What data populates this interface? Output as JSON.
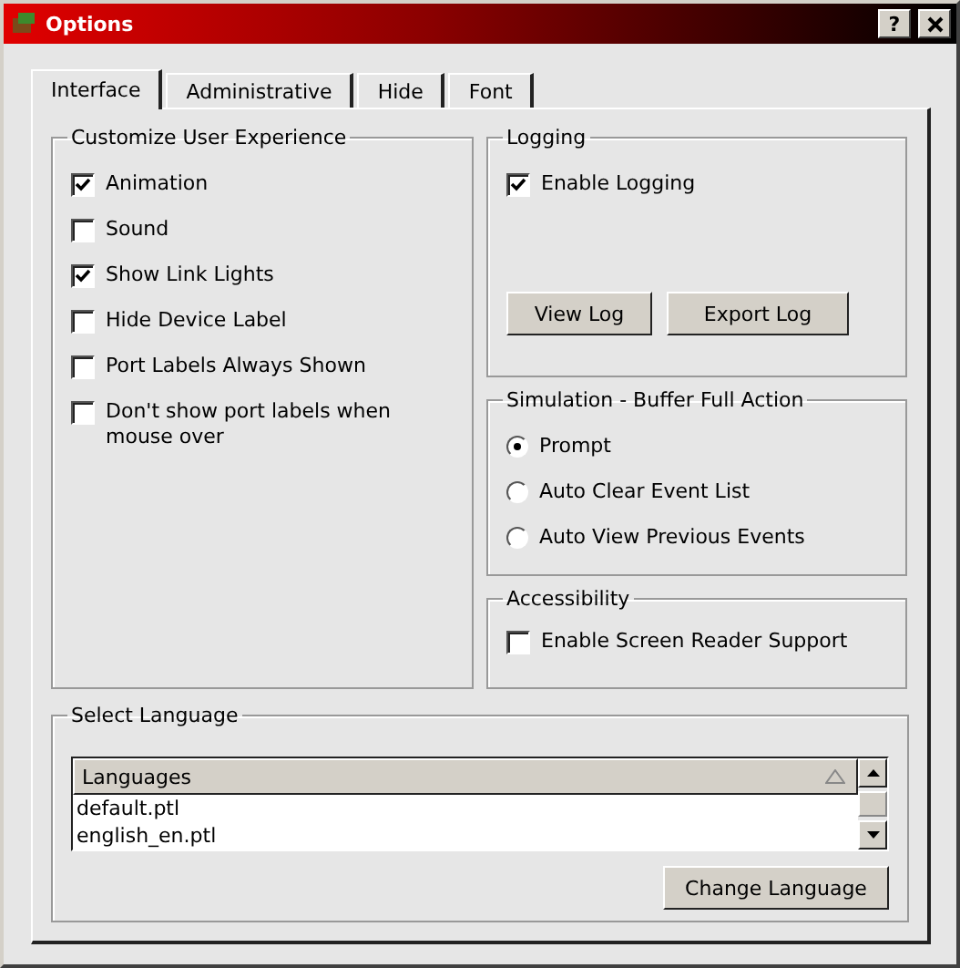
{
  "window": {
    "title": "Options",
    "help_button": "?"
  },
  "tabs": [
    {
      "label": "Interface",
      "selected": true
    },
    {
      "label": "Administrative",
      "selected": false
    },
    {
      "label": "Hide",
      "selected": false
    },
    {
      "label": "Font",
      "selected": false
    }
  ],
  "customize": {
    "title": "Customize User Experience",
    "options": [
      {
        "label": "Animation",
        "checked": true
      },
      {
        "label": "Sound",
        "checked": false
      },
      {
        "label": "Show Link Lights",
        "checked": true
      },
      {
        "label": "Hide Device Label",
        "checked": false
      },
      {
        "label": "Port Labels Always Shown",
        "checked": false
      },
      {
        "label": "Don't show port labels when mouse over",
        "checked": false
      }
    ]
  },
  "logging": {
    "title": "Logging",
    "option": {
      "label": "Enable Logging",
      "checked": true
    },
    "buttons": [
      "View Log",
      "Export Log"
    ]
  },
  "simulation": {
    "title": "Simulation - Buffer Full Action",
    "options": [
      {
        "label": "Prompt",
        "selected": true
      },
      {
        "label": "Auto Clear Event List",
        "selected": false
      },
      {
        "label": "Auto View Previous Events",
        "selected": false
      }
    ]
  },
  "accessibility": {
    "title": "Accessibility",
    "option": {
      "label": "Enable Screen Reader Support",
      "checked": false
    }
  },
  "language": {
    "title": "Select Language",
    "column": "Languages",
    "rows": [
      "default.ptl",
      "english_en.ptl"
    ],
    "button": "Change Language"
  }
}
